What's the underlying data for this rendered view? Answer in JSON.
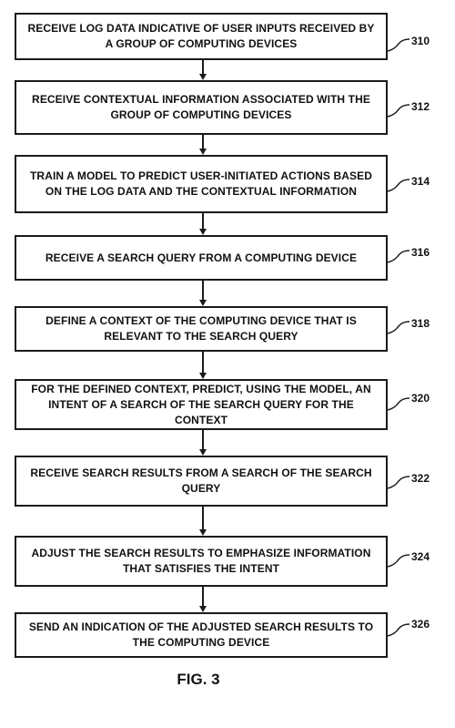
{
  "steps": [
    {
      "text": "RECEIVE LOG DATA INDICATIVE OF USER INPUTS RECEIVED BY A GROUP OF COMPUTING DEVICES",
      "ref": "310"
    },
    {
      "text": "RECEIVE CONTEXTUAL INFORMATION ASSOCIATED WITH THE GROUP OF COMPUTING DEVICES",
      "ref": "312"
    },
    {
      "text": "TRAIN A MODEL TO PREDICT USER-INITIATED ACTIONS BASED ON THE LOG DATA AND THE CONTEXTUAL INFORMATION",
      "ref": "314"
    },
    {
      "text": "RECEIVE A SEARCH QUERY FROM A COMPUTING DEVICE",
      "ref": "316"
    },
    {
      "text": "DEFINE A CONTEXT OF THE COMPUTING DEVICE THAT IS RELEVANT TO THE SEARCH QUERY",
      "ref": "318"
    },
    {
      "text": "FOR THE DEFINED CONTEXT, PREDICT, USING THE MODEL, AN INTENT OF A SEARCH OF THE SEARCH QUERY FOR THE CONTEXT",
      "ref": "320"
    },
    {
      "text": "RECEIVE SEARCH RESULTS FROM A SEARCH OF THE SEARCH QUERY",
      "ref": "322"
    },
    {
      "text": "ADJUST THE SEARCH RESULTS TO EMPHASIZE INFORMATION THAT SATISFIES THE INTENT",
      "ref": "324"
    },
    {
      "text": "SEND AN INDICATION OF THE ADJUSTED SEARCH RESULTS TO THE COMPUTING DEVICE",
      "ref": "326"
    }
  ],
  "figure_label": "FIG. 3"
}
